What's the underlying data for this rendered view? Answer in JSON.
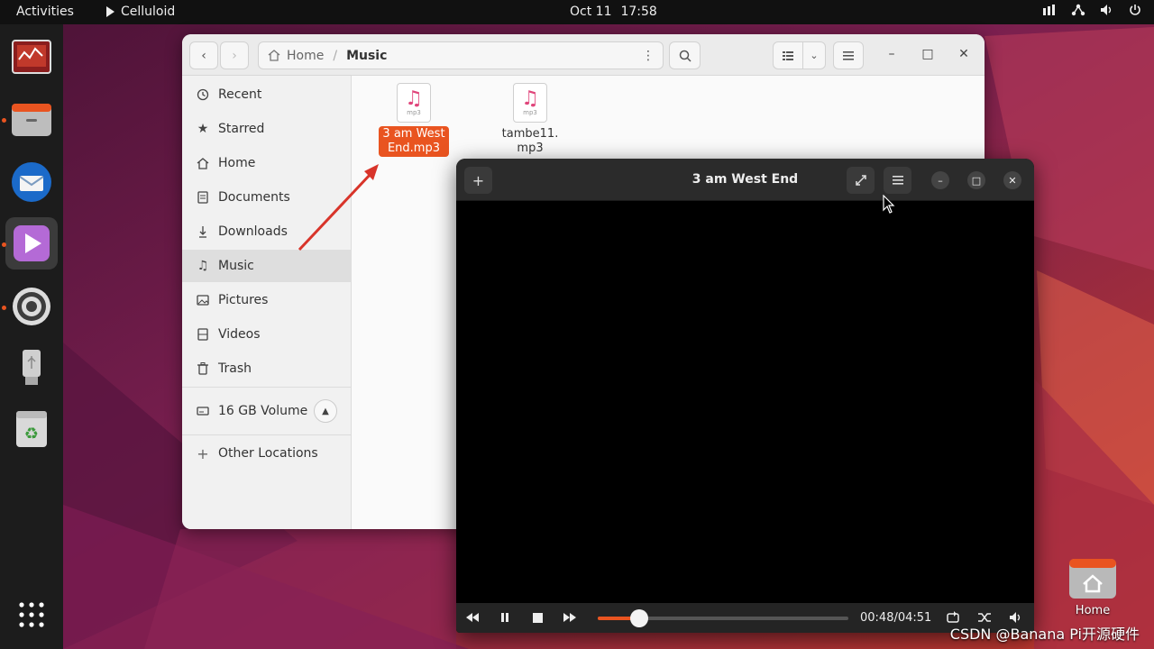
{
  "topbar": {
    "activities": "Activities",
    "app_name": "Celluloid",
    "date": "Oct 11",
    "time": "17:58"
  },
  "dock": {
    "items": [
      "system-monitor-icon",
      "files-icon",
      "thunderbird-icon",
      "celluloid-icon",
      "settings-icon",
      "usb-drive-icon",
      "trash-icon",
      "app-grid-icon"
    ]
  },
  "files_window": {
    "path": [
      "Home",
      "Music"
    ],
    "sidebar": {
      "items": [
        {
          "label": "Recent",
          "icon": "clock-icon"
        },
        {
          "label": "Starred",
          "icon": "star-icon"
        },
        {
          "label": "Home",
          "icon": "home-icon"
        },
        {
          "label": "Documents",
          "icon": "document-icon"
        },
        {
          "label": "Downloads",
          "icon": "download-icon"
        },
        {
          "label": "Music",
          "icon": "music-icon"
        },
        {
          "label": "Pictures",
          "icon": "picture-icon"
        },
        {
          "label": "Videos",
          "icon": "video-icon"
        },
        {
          "label": "Trash",
          "icon": "trash-icon"
        }
      ],
      "volume": "16 GB Volume",
      "other": "Other Locations"
    },
    "files": [
      {
        "name_line1": "3 am West",
        "name_line2": "End.mp3",
        "ext": "mp3",
        "selected": true
      },
      {
        "name_line1": "tambe11.",
        "name_line2": "mp3",
        "ext": "mp3",
        "selected": false
      }
    ]
  },
  "player": {
    "title": "3 am West End",
    "elapsed": "00:48",
    "duration": "04:51",
    "time_display": "00:48/04:51",
    "progress": 0.165
  },
  "desktop": {
    "home_label": "Home"
  },
  "watermark": "CSDN @Banana Pi开源硬件",
  "colors": {
    "accent": "#e95420",
    "topbar": "#111111",
    "dock": "#1c1c1c"
  }
}
